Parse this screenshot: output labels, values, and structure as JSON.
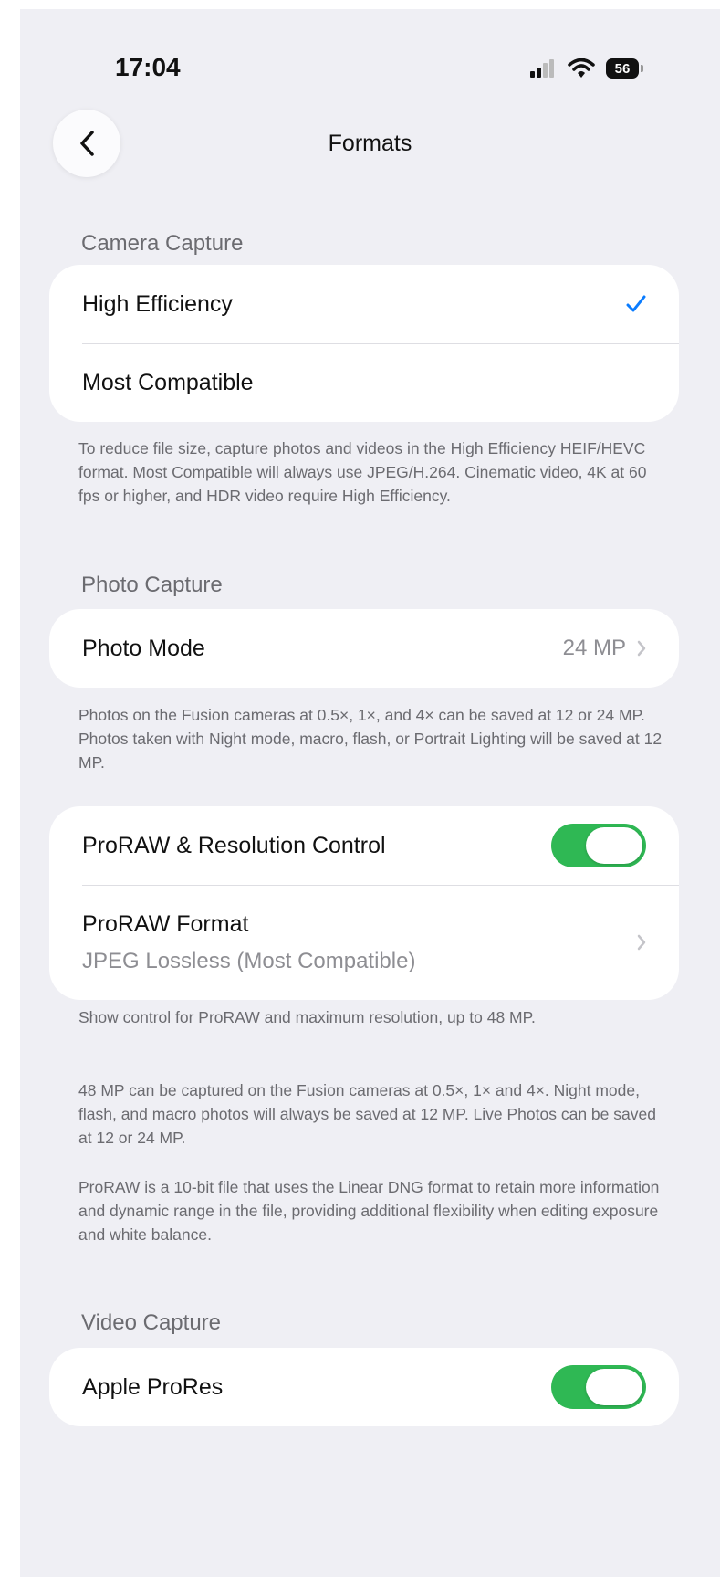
{
  "status_bar": {
    "time": "17:04",
    "battery_level": "56",
    "signal_icon": "cellular-signal-icon",
    "wifi_icon": "wifi-icon"
  },
  "nav": {
    "title": "Formats",
    "back_icon": "chevron-left-icon"
  },
  "accent_colors": {
    "checkmark": "#0a7cff",
    "toggle_on": "#2fb854",
    "background": "#efeff4"
  },
  "camera_capture": {
    "header": "Camera Capture",
    "options": [
      {
        "label": "High Efficiency",
        "selected": true
      },
      {
        "label": "Most Compatible",
        "selected": false
      }
    ],
    "footer": "To reduce file size, capture photos and videos in the High Efficiency HEIF/HEVC format. Most Compatible will always use JPEG/H.264. Cinematic video, 4K at 60 fps or higher, and HDR video require High Efficiency."
  },
  "photo_capture": {
    "header": "Photo Capture",
    "photo_mode_label": "Photo Mode",
    "photo_mode_value": "24 MP",
    "footer": "Photos on the Fusion cameras at 0.5×, 1×, and 4× can be saved at 12 or 24 MP. Photos taken with Night mode, macro, flash, or Portrait Lighting will be saved at 12 MP."
  },
  "proraw": {
    "toggle_label": "ProRAW & Resolution Control",
    "toggle_on": true,
    "format_label": "ProRAW Format",
    "format_value": "JPEG Lossless (Most Compatible)",
    "footer_1": "Show control for ProRAW and maximum resolution, up to 48 MP.",
    "footer_2": "48 MP can be captured on the Fusion cameras at 0.5×, 1× and 4×. Night mode, flash, and macro photos will always be saved at 12 MP. Live Photos can be saved at 12 or 24 MP.",
    "footer_3": "ProRAW is a 10-bit file that uses the Linear DNG format to retain more information and dynamic range in the file, providing additional flexibility when editing exposure and white balance."
  },
  "video_capture": {
    "header": "Video Capture",
    "prores_label": "Apple ProRes",
    "prores_on": true
  }
}
